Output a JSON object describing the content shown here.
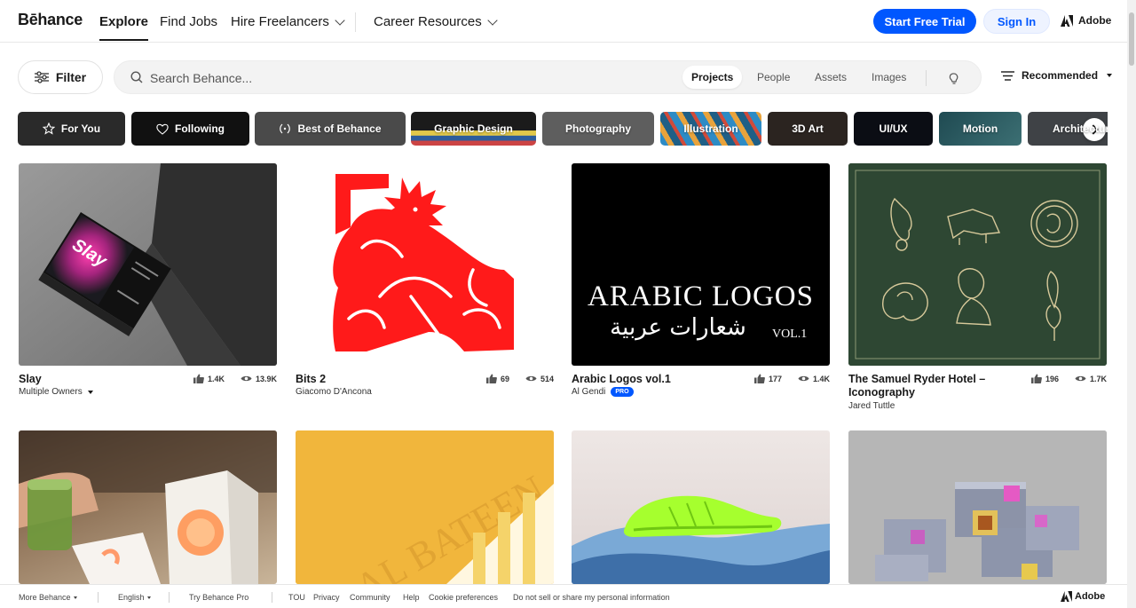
{
  "header": {
    "logo": "Bēhance",
    "nav": [
      {
        "label": "Explore",
        "active": true
      },
      {
        "label": "Find Jobs"
      },
      {
        "label": "Hire Freelancers"
      },
      {
        "label": "Career Resources"
      }
    ],
    "start_trial": "Start Free Trial",
    "sign_in": "Sign In",
    "adobe": "Adobe"
  },
  "search": {
    "filter_label": "Filter",
    "placeholder": "Search Behance...",
    "tabs": [
      "Projects",
      "People",
      "Assets",
      "Images"
    ],
    "active_tab": "Projects",
    "sort_label": "Recommended"
  },
  "categories": [
    {
      "label": "For You",
      "icon": "star-icon"
    },
    {
      "label": "Following",
      "icon": "heart-icon"
    },
    {
      "label": "Best of Behance",
      "icon": "laurel-icon"
    },
    {
      "label": "Graphic Design"
    },
    {
      "label": "Photography"
    },
    {
      "label": "Illustration"
    },
    {
      "label": "3D Art"
    },
    {
      "label": "UI/UX"
    },
    {
      "label": "Motion"
    },
    {
      "label": "Architecture"
    }
  ],
  "projects": [
    {
      "title": "Slay",
      "owner": "Multiple Owners",
      "likes": "1.4K",
      "views": "13.9K"
    },
    {
      "title": "Bits 2",
      "owner": "Giacomo D'Ancona",
      "likes": "69",
      "views": "514"
    },
    {
      "title": "Arabic Logos vol.1",
      "owner": "Al Gendi",
      "badge": "PRO",
      "likes": "177",
      "views": "1.4K",
      "art_title": "ARABIC LOGOS",
      "art_arabic": "شعارات عربية",
      "art_vol": "VOL.1"
    },
    {
      "title_line1": "The Samuel Ryder Hotel –",
      "title_line2": "Iconography",
      "owner": "Jared Tuttle",
      "likes": "196",
      "views": "1.7K"
    }
  ],
  "footer": {
    "more": "More Behance",
    "language": "English",
    "pro": "Try Behance Pro",
    "links": [
      "TOU",
      "Privacy",
      "Community",
      "Help",
      "Cookie preferences",
      "Do not sell or share my personal information"
    ],
    "adobe": "Adobe"
  }
}
